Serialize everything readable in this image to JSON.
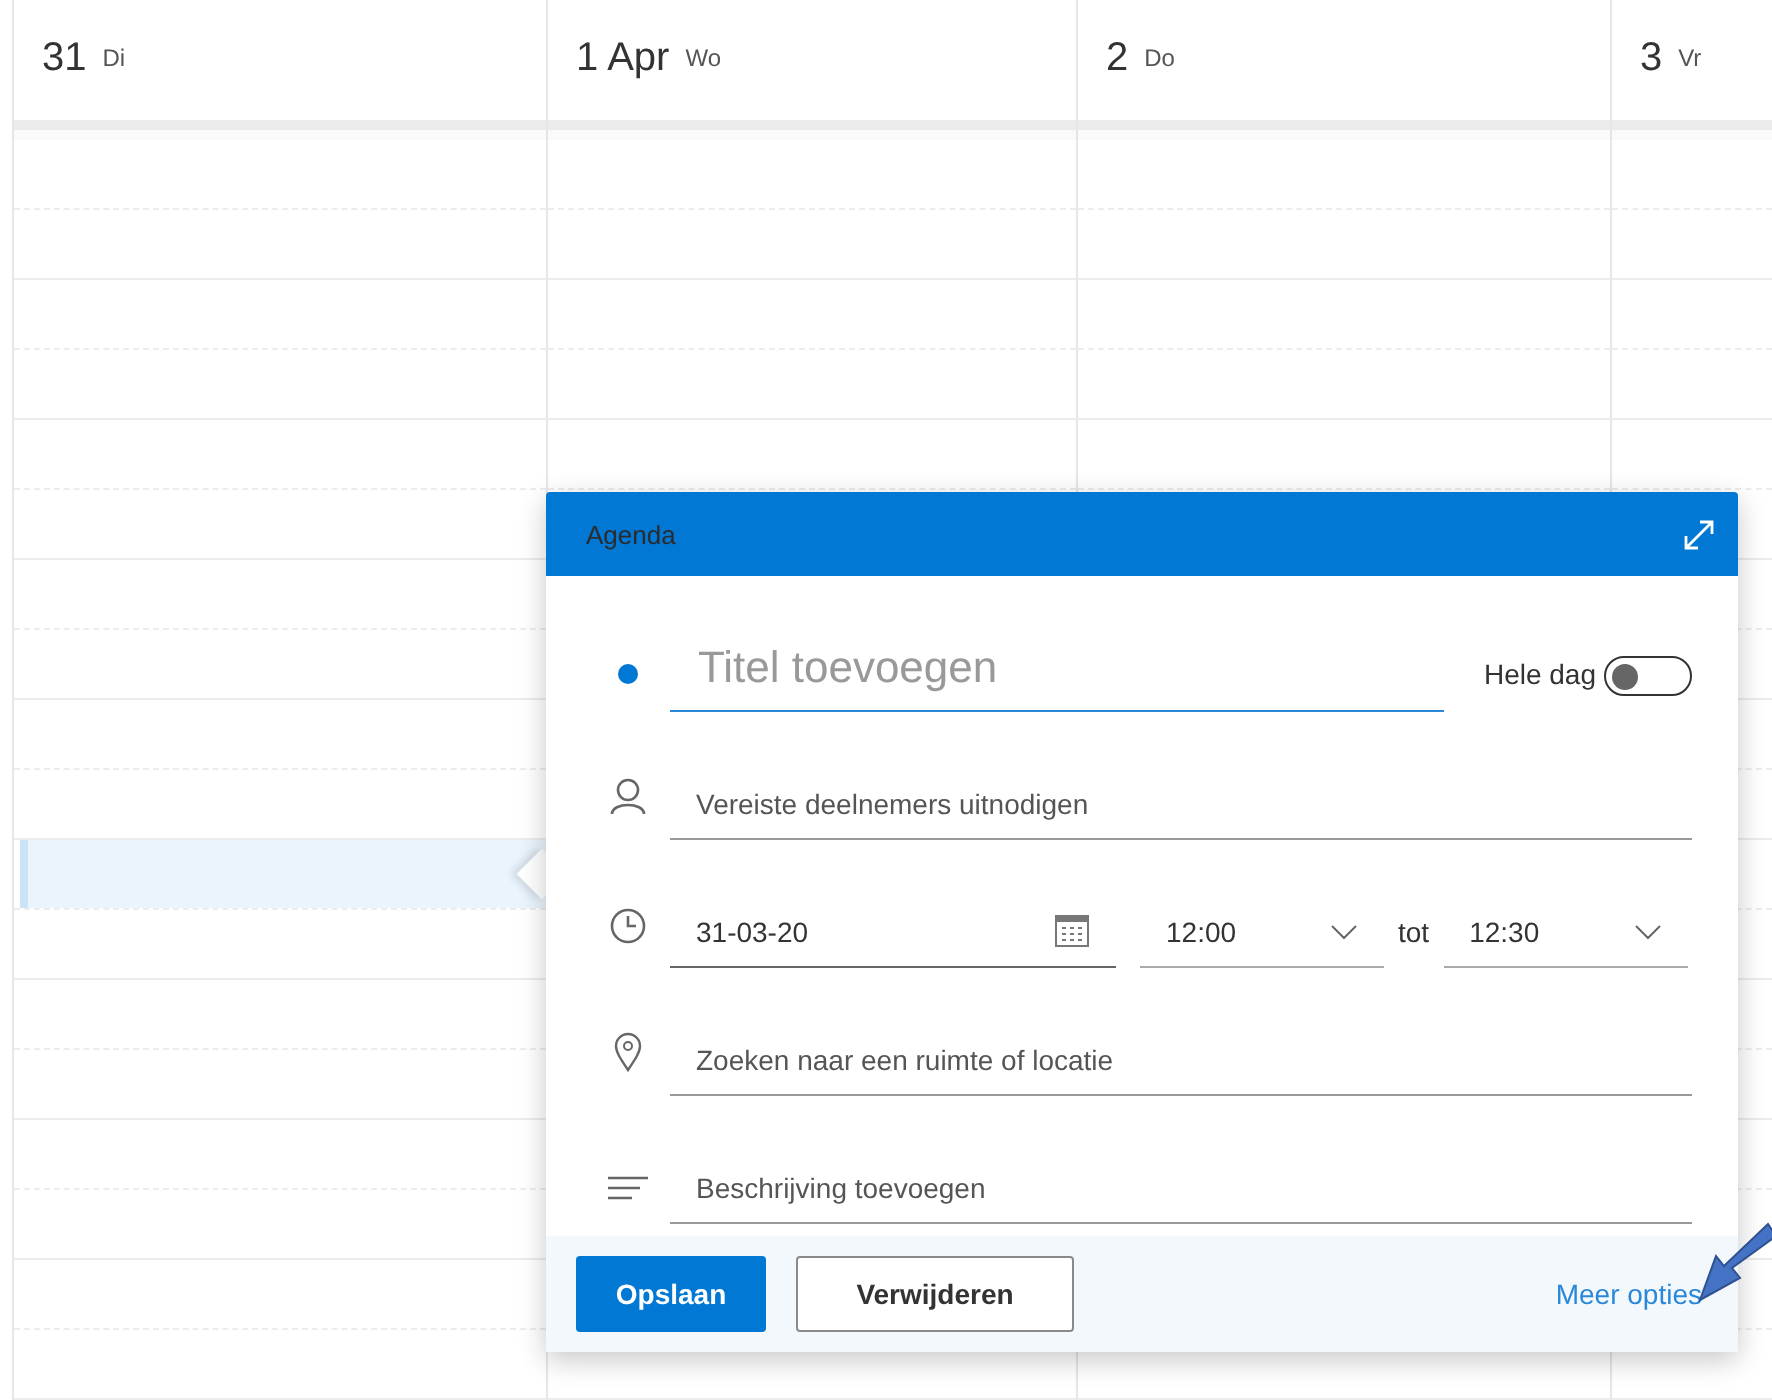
{
  "days": [
    {
      "number": "31",
      "weekday": "Di"
    },
    {
      "number": "1 Apr",
      "weekday": "Wo"
    },
    {
      "number": "2",
      "weekday": "Do"
    },
    {
      "number": "3",
      "weekday": "Vr"
    }
  ],
  "time_slot": {
    "selected": true
  },
  "event_dialog": {
    "calendar": "Agenda",
    "color": "#0078d4",
    "title_placeholder": "Titel toevoegen",
    "all_day": {
      "label": "Hele dag",
      "on": false
    },
    "attendees_placeholder": "Vereiste deelnemers uitnodigen",
    "date": "31-03-20",
    "start_time": "12:00",
    "to_label": "tot",
    "end_time": "12:30",
    "location_placeholder": "Zoeken naar een ruimte of locatie",
    "description_placeholder": "Beschrijving toevoegen",
    "buttons": [
      {
        "label": "Opslaan",
        "kind": "primary"
      },
      {
        "label": "Verwijderen",
        "kind": "secondary"
      }
    ],
    "more_link": "Meer opties"
  }
}
